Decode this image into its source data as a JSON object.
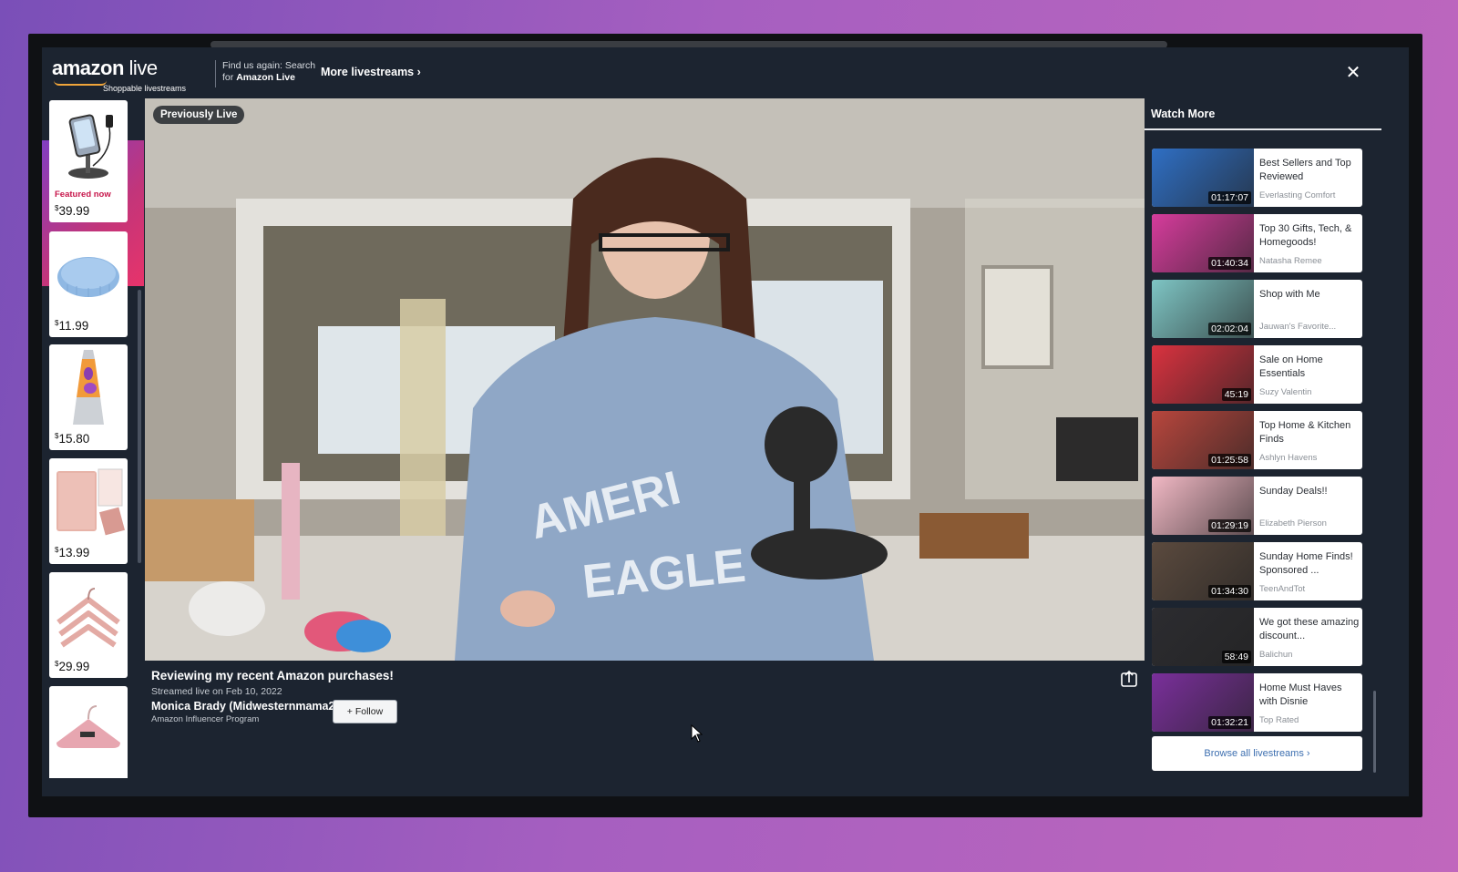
{
  "header": {
    "logo_main": "amazon",
    "logo_live": "live",
    "logo_sub": "Shoppable livestreams",
    "find_us_line1": "Find us again: Search",
    "find_us_line2_prefix": "for",
    "find_us_line2_bold": "Amazon Live",
    "more_livestreams": "More livestreams ›",
    "close_icon": "close-icon"
  },
  "products": [
    {
      "price": "39.99",
      "currency": "$",
      "featured_label": "Featured now",
      "icon": "phone-charger-stand"
    },
    {
      "price": "11.99",
      "currency": "$",
      "icon": "bath-brush"
    },
    {
      "price": "15.80",
      "currency": "$",
      "icon": "lava-lamp"
    },
    {
      "price": "13.99",
      "currency": "$",
      "icon": "passport-wallet"
    },
    {
      "price": "29.99",
      "currency": "$",
      "icon": "hangers"
    },
    {
      "price": "",
      "currency": "",
      "icon": "velvet-hanger"
    }
  ],
  "video": {
    "badge": "Previously Live",
    "title": "Reviewing my recent Amazon purchases!",
    "streamed": "Streamed live on Feb 10, 2022",
    "creator": "Monica Brady (Midwesternmama29)",
    "program": "Amazon Influencer Program",
    "follow_label": "+ Follow",
    "share_icon": "share-icon"
  },
  "watch_more": {
    "title": "Watch More",
    "items": [
      {
        "title": "Best Sellers and Top Reviewed",
        "author": "Everlasting Comfort",
        "duration": "01:17:07",
        "thumb_color": "#2f6fc4"
      },
      {
        "title": "Top 30 Gifts, Tech, & Homegoods!",
        "author": "Natasha Remee",
        "duration": "01:40:34",
        "thumb_color": "#d63c9c"
      },
      {
        "title": "Shop with Me",
        "author": "Jauwan's Favorite...",
        "duration": "02:02:04",
        "thumb_color": "#7ec5c4"
      },
      {
        "title": "Sale on Home Essentials",
        "author": "Suzy Valentin",
        "duration": "45:19",
        "thumb_color": "#d9323f"
      },
      {
        "title": "Top Home & Kitchen Finds",
        "author": "Ashlyn Havens",
        "duration": "01:25:58",
        "thumb_color": "#b8463d"
      },
      {
        "title": "Sunday Deals!!",
        "author": "Elizabeth Pierson",
        "duration": "01:29:19",
        "thumb_color": "#f1b8c4"
      },
      {
        "title": "Sunday Home Finds! Sponsored ...",
        "author": "TeenAndTot",
        "duration": "01:34:30",
        "thumb_color": "#5b4a3e"
      },
      {
        "title": "We got these amazing discount...",
        "author": "Balichun",
        "duration": "58:49",
        "thumb_color": "#2c2c30"
      },
      {
        "title": "Home Must Haves with Disnie",
        "author": "Top Rated",
        "duration": "01:32:21",
        "thumb_color": "#7a2f9b"
      }
    ],
    "browse_all": "Browse all livestreams ›"
  }
}
